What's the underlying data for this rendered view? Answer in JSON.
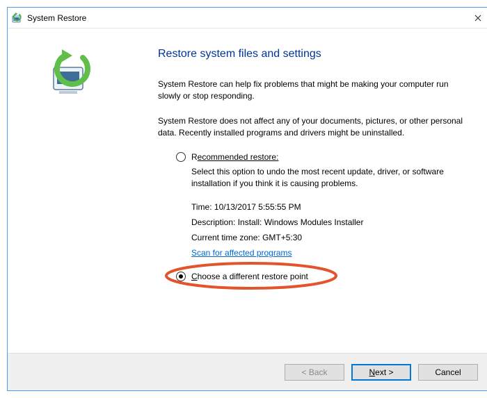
{
  "titlebar": {
    "title": "System Restore"
  },
  "heading": "Restore system files and settings",
  "para1": "System Restore can help fix problems that might be making your computer run slowly or stop responding.",
  "para2": "System Restore does not affect any of your documents, pictures, or other personal data. Recently installed programs and drivers might be uninstalled.",
  "recommended": {
    "label_pre": "R",
    "label_ul": "ecommended restore:",
    "hint": "Select this option to undo the most recent update, driver, or software installation if you think it is causing problems.",
    "time_label": "Time:",
    "time_value": "10/13/2017 5:55:55 PM",
    "desc_label": "Description:",
    "desc_value": "Install: Windows Modules Installer",
    "tz_label": "Current time zone:",
    "tz_value": "GMT+5:30",
    "scan_link": "Scan for affected programs"
  },
  "choose": {
    "label_ul": "C",
    "label_rest": "hoose a different restore point"
  },
  "footer": {
    "back": "< Back",
    "next_ul": "N",
    "next_rest": "ext >",
    "cancel": "Cancel"
  }
}
